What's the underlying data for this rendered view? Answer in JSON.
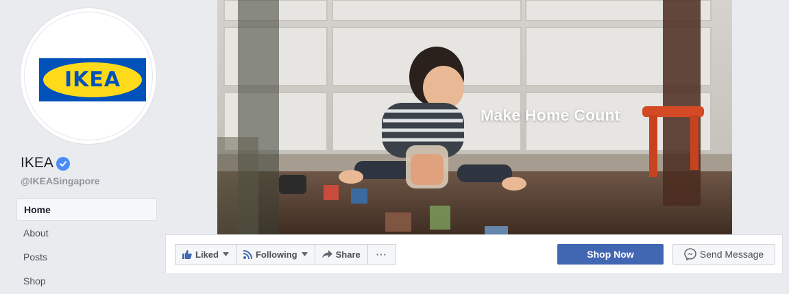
{
  "profile": {
    "logo_text": "IKEA",
    "name": "IKEA",
    "handle": "@IKEASingapore",
    "verified_icon": "verified-badge-icon",
    "colors": {
      "logo_blue": "#0051ba",
      "logo_yellow": "#ffda1a",
      "verified": "#4b8df8"
    }
  },
  "nav": {
    "items": [
      {
        "label": "Home",
        "active": true
      },
      {
        "label": "About",
        "active": false
      },
      {
        "label": "Posts",
        "active": false
      },
      {
        "label": "Shop",
        "active": false
      }
    ]
  },
  "cover": {
    "tagline": "Make Home Count"
  },
  "actions": {
    "liked": {
      "label": "Liked",
      "icon": "thumbs-up-icon"
    },
    "following": {
      "label": "Following",
      "icon": "rss-icon"
    },
    "share": {
      "label": "Share",
      "icon": "share-arrow-icon"
    },
    "more": {
      "label": "···",
      "icon": "more-dots-icon"
    },
    "shop_now": {
      "label": "Shop Now"
    },
    "send_message": {
      "label": "Send Message",
      "icon": "messenger-icon"
    },
    "colors": {
      "primary": "#4267b2"
    }
  }
}
